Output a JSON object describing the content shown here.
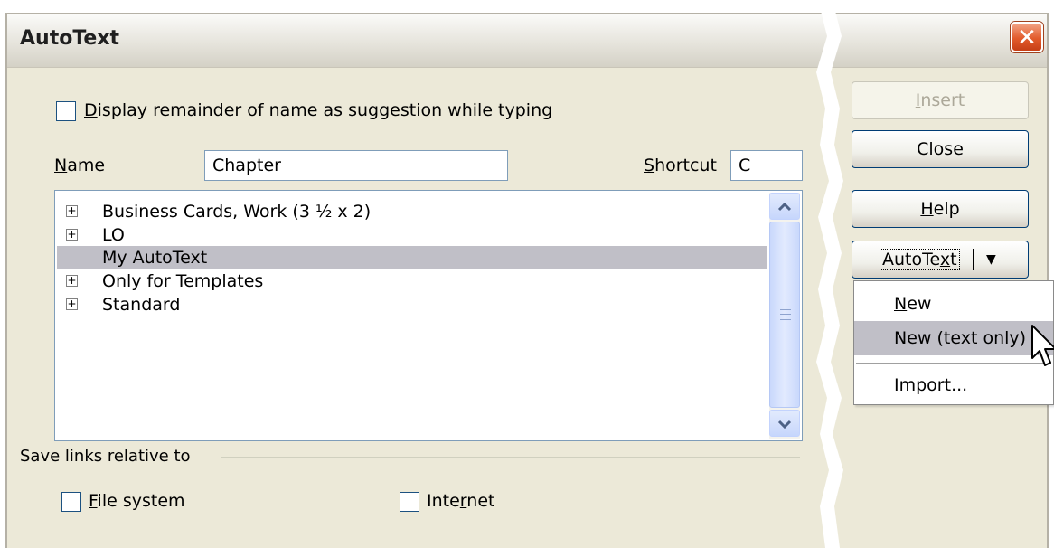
{
  "window": {
    "title": "AutoText",
    "close_icon": "close-x-icon"
  },
  "options": {
    "display_remainder_label_pre": "",
    "display_remainder_mnemonic": "D",
    "display_remainder_label_post": "isplay remainder of name as suggestion while typing",
    "display_remainder_checked": false
  },
  "name_field": {
    "label_mnemonic": "N",
    "label_rest": "ame",
    "value": "Chapter"
  },
  "shortcut_field": {
    "label_mnemonic": "S",
    "label_rest": "hortcut",
    "value": "C"
  },
  "tree": {
    "items": [
      {
        "label": "Business Cards, Work (3 ½ x 2)",
        "expandable": true,
        "selected": false
      },
      {
        "label": "LO",
        "expandable": true,
        "selected": false
      },
      {
        "label": "My AutoText",
        "expandable": false,
        "selected": true
      },
      {
        "label": "Only for Templates",
        "expandable": true,
        "selected": false
      },
      {
        "label": "Standard",
        "expandable": true,
        "selected": false
      }
    ],
    "expand_glyph": "⊞",
    "scroll_up_glyph": "˄",
    "scroll_down_glyph": "˅"
  },
  "save_links": {
    "heading": "Save links relative to",
    "file_system": {
      "mnemonic": "F",
      "rest": "ile system",
      "checked": false
    },
    "internet": {
      "pre": "Inte",
      "mnemonic": "r",
      "post": "net",
      "checked": false
    }
  },
  "buttons": {
    "insert": {
      "mnemonic": "I",
      "rest": "nsert",
      "enabled": false
    },
    "close": {
      "mnemonic": "C",
      "rest": "lose"
    },
    "help": {
      "mnemonic": "H",
      "rest": "elp"
    },
    "autotext": {
      "pre": "AutoTe",
      "mnemonic": "x",
      "post": "t",
      "arrow": "▼"
    }
  },
  "autotext_menu": {
    "items": [
      {
        "pre": "",
        "mnemonic": "N",
        "post": "ew",
        "highlighted": false
      },
      {
        "pre": "New (text ",
        "mnemonic": "o",
        "post": "nly)",
        "highlighted": true
      },
      {
        "pre": "",
        "mnemonic": "I",
        "post": "mport...",
        "highlighted": false
      }
    ]
  },
  "colors": {
    "dialog_bg": "#ece9d8",
    "selection": "#c0bfc7",
    "close_button": "#e25b2c",
    "field_border": "#7f9db9"
  }
}
